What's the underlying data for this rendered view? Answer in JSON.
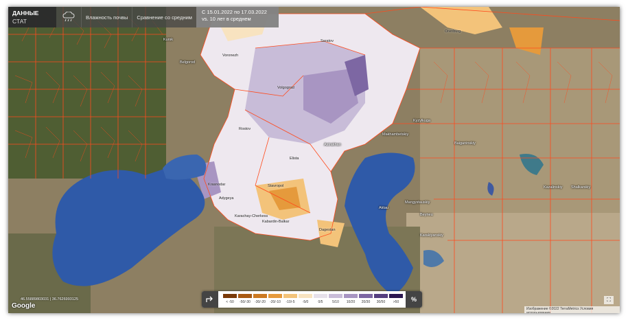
{
  "header": {
    "title": "ДАННЫЕ",
    "subtitle": "СТАТ",
    "layer_label": "Влажность почвы",
    "compare_label": "Сравнение со средним",
    "range_text": "С 15.01.2022 по 17.03.2022 vs. 10 лет в среднем"
  },
  "colors": {
    "border": "#ff4a1c",
    "sea": "#2f5aa8",
    "land": "#8a7a5e",
    "highlight": "#f0a040"
  },
  "icons": {
    "weather": "cloud-rain-icon",
    "share": "share-icon",
    "percent": "percent-icon",
    "fullscreen": "fullscreen-icon"
  },
  "legend": {
    "items": [
      {
        "label": "< -50",
        "color": "#7a3a08"
      },
      {
        "label": "-50/-30",
        "color": "#a85a12"
      },
      {
        "label": "-30/-20",
        "color": "#cc7a22"
      },
      {
        "label": "-20/-10",
        "color": "#e59a3c"
      },
      {
        "label": "-10/-5",
        "color": "#f3c37a"
      },
      {
        "label": "-5/0",
        "color": "#f8e3c0"
      },
      {
        "label": "0/5",
        "color": "#e6e0ea"
      },
      {
        "label": "5/10",
        "color": "#c9bcd8"
      },
      {
        "label": "10/20",
        "color": "#a895c2"
      },
      {
        "label": "20/30",
        "color": "#7d67a3"
      },
      {
        "label": "30/50",
        "color": "#553f80"
      },
      {
        "label": ">50",
        "color": "#2a1650"
      }
    ],
    "percent_label": "%"
  },
  "cities": [
    {
      "name": "Kursk"
    },
    {
      "name": "Belgorod"
    },
    {
      "name": "Voronezh"
    },
    {
      "name": "Saratov"
    },
    {
      "name": "Orenburg"
    },
    {
      "name": "Volgograd"
    },
    {
      "name": "Rostov"
    },
    {
      "name": "Astrakhan"
    },
    {
      "name": "Elista"
    },
    {
      "name": "Krasnodar"
    },
    {
      "name": "Stavropol"
    },
    {
      "name": "Adygeya"
    },
    {
      "name": "Karachay-Cherkess"
    },
    {
      "name": "Kabardin-Balkar"
    },
    {
      "name": "Dagestan"
    },
    {
      "name": "Makhambetskiy"
    },
    {
      "name": "Kyzylkuga"
    },
    {
      "name": "Baiganinskiy"
    },
    {
      "name": "Shalkarskiy"
    },
    {
      "name": "Mangystauskiy"
    },
    {
      "name": "Beyneu"
    },
    {
      "name": "Karakiyanskiy"
    },
    {
      "name": "Kazalinskiy"
    },
    {
      "name": "Aktau"
    }
  ],
  "footer": {
    "coordinates": "46.55889803031 | 36.7626993125",
    "google": "Google",
    "attribution": "Изображение ©2022 TerraMetrics  Условия использования"
  }
}
